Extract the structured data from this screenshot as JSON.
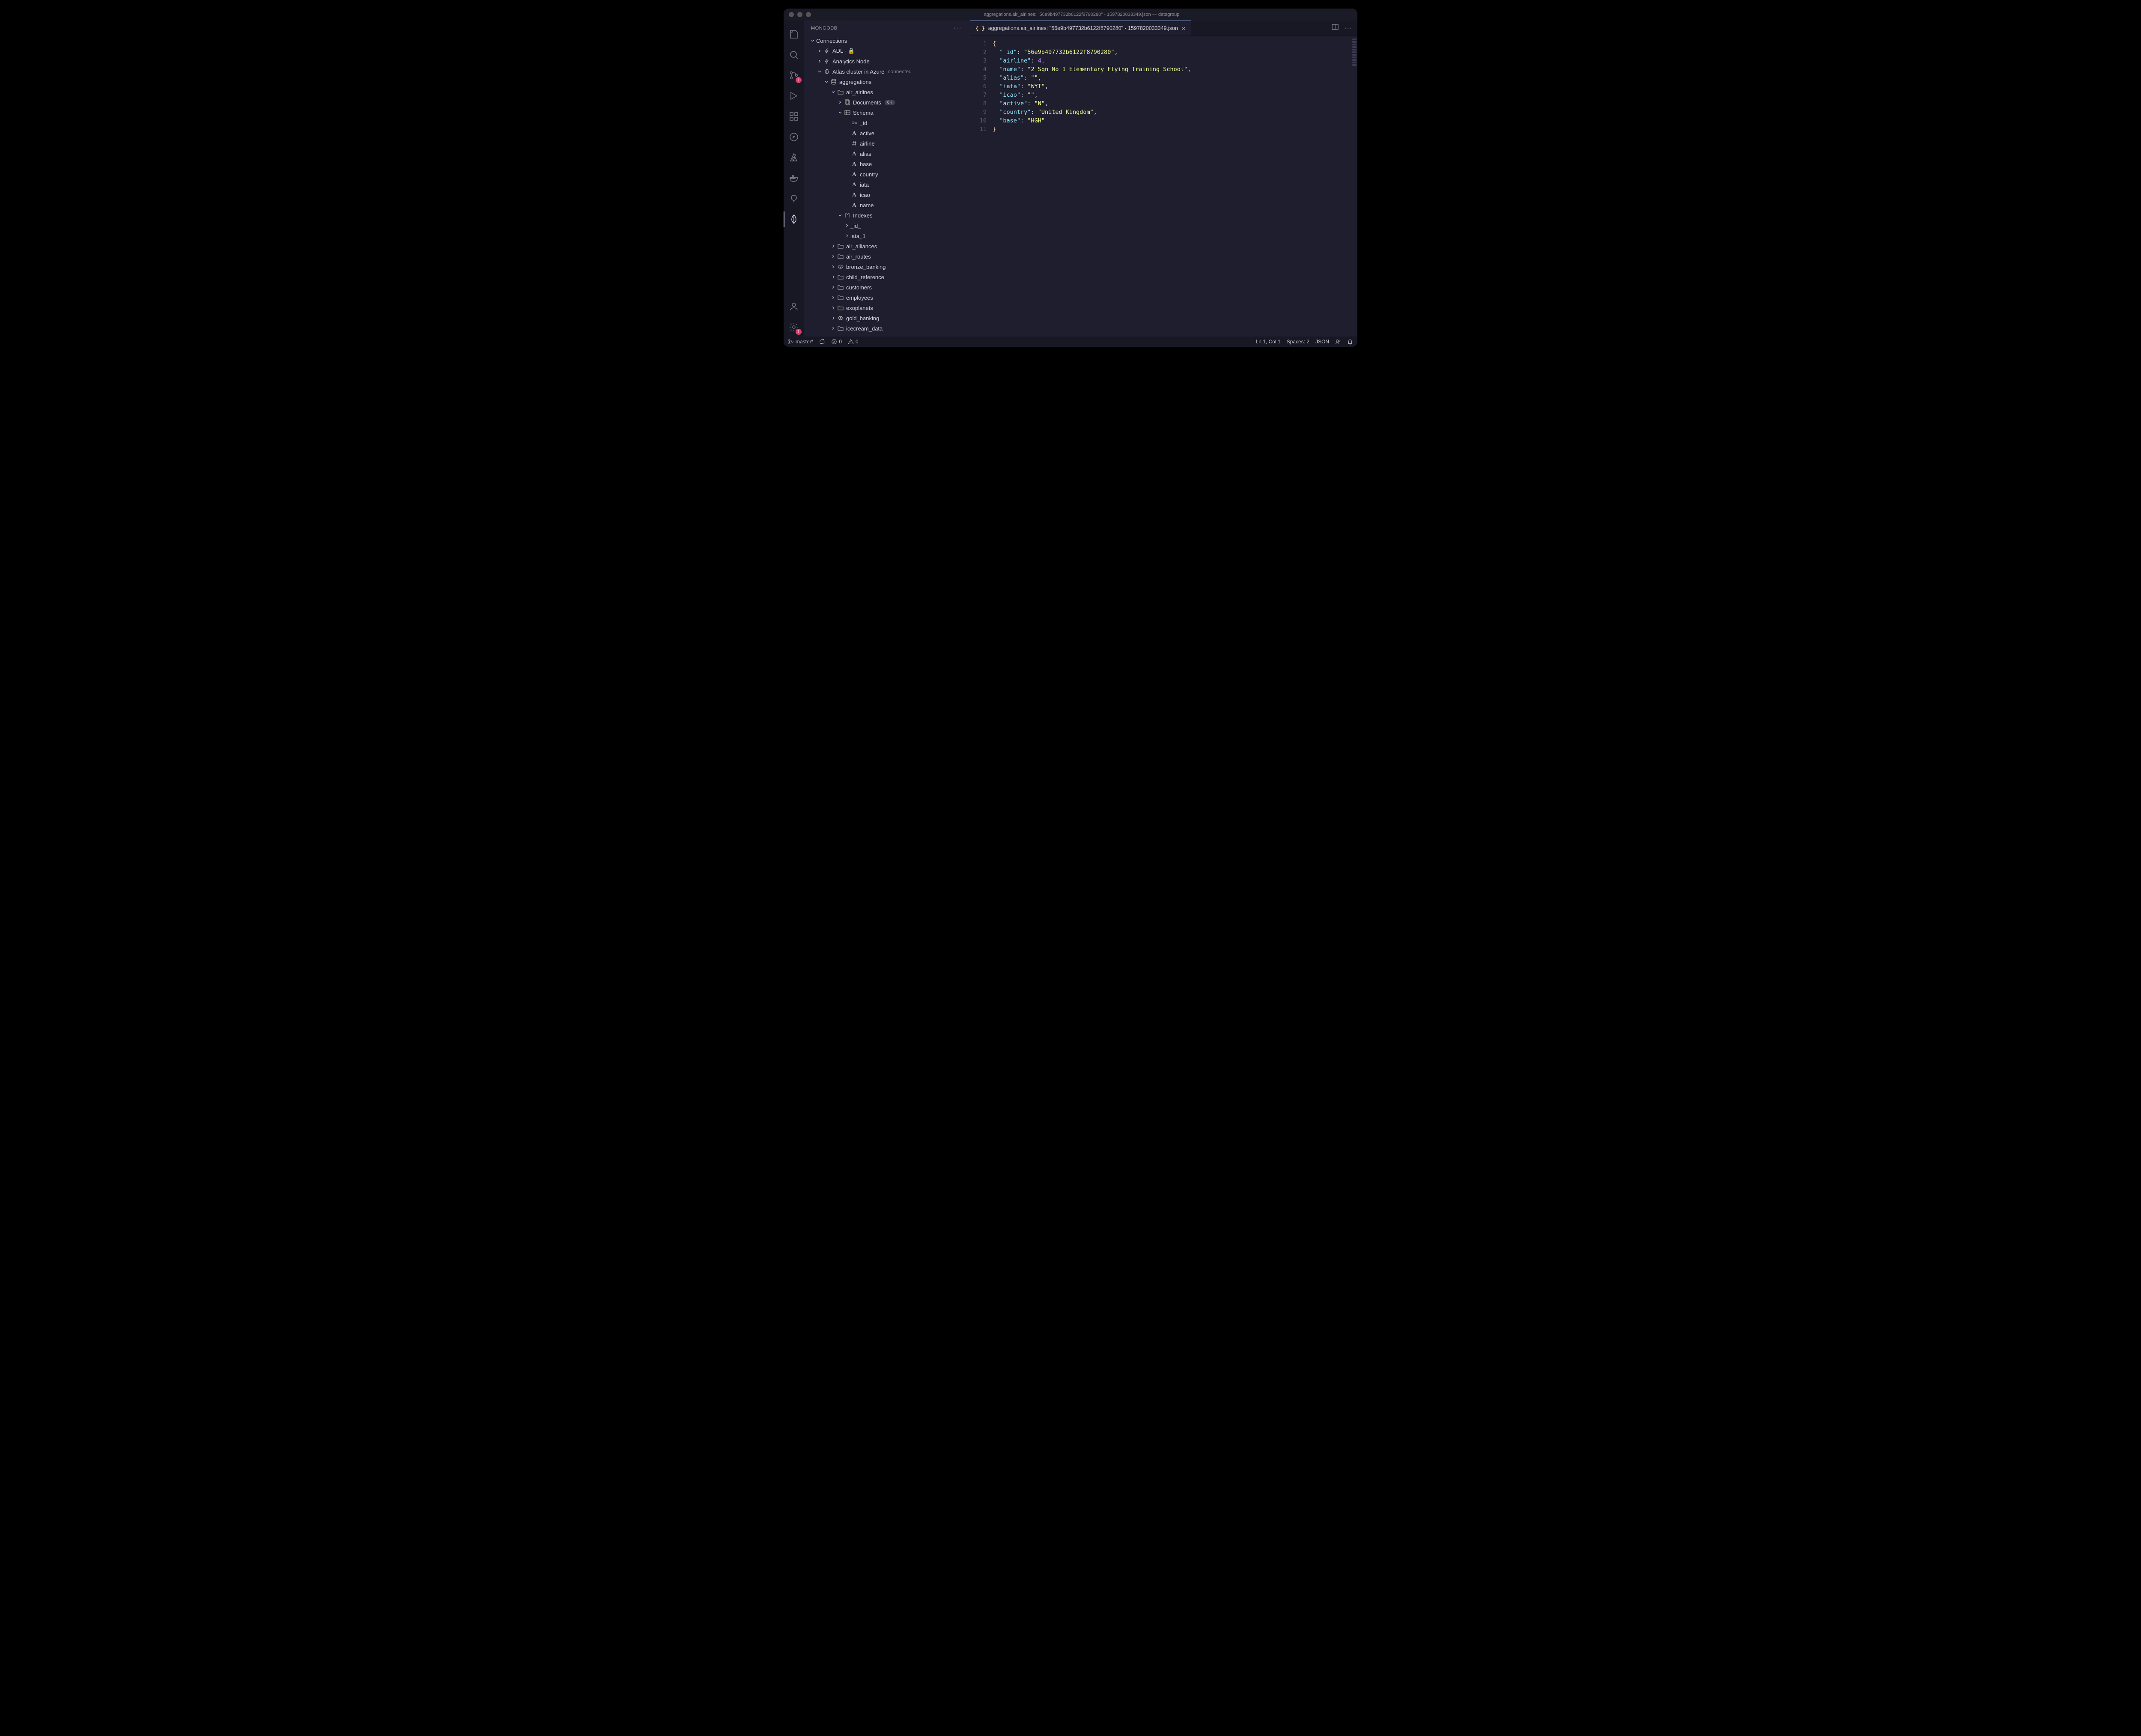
{
  "window": {
    "title": "aggregations.air_airlines: \"56e9b497732b6122f8790280\" - 1597820033349.json — datagroup"
  },
  "sidebar": {
    "title": "MONGODB",
    "section": "Connections",
    "connections": [
      {
        "label": "ADL - 🔒",
        "type": "bolt"
      },
      {
        "label": "Analytics Node",
        "type": "bolt"
      }
    ],
    "cluster": {
      "label": "Atlas cluster in Azure",
      "status": "connected"
    },
    "database": "aggregations",
    "collection": "air_airlines",
    "docs_label": "Documents",
    "docs_count": "6K",
    "schema_label": "Schema",
    "schema_fields": [
      {
        "name": "_id",
        "type": "key"
      },
      {
        "name": "active",
        "type": "str"
      },
      {
        "name": "airline",
        "type": "num"
      },
      {
        "name": "alias",
        "type": "str"
      },
      {
        "name": "base",
        "type": "str"
      },
      {
        "name": "country",
        "type": "str"
      },
      {
        "name": "iata",
        "type": "str"
      },
      {
        "name": "icao",
        "type": "str"
      },
      {
        "name": "name",
        "type": "str"
      }
    ],
    "indexes_label": "Indexes",
    "indexes": [
      "_id_",
      "iata_1"
    ],
    "other_collections": [
      {
        "name": "air_alliances",
        "view": false
      },
      {
        "name": "air_routes",
        "view": false
      },
      {
        "name": "bronze_banking",
        "view": true
      },
      {
        "name": "child_reference",
        "view": false
      },
      {
        "name": "customers",
        "view": false
      },
      {
        "name": "employees",
        "view": false
      },
      {
        "name": "exoplanets",
        "view": false
      },
      {
        "name": "gold_banking",
        "view": true
      },
      {
        "name": "icecream_data",
        "view": false
      }
    ]
  },
  "tab": {
    "filename": "aggregations.air_airlines: \"56e9b497732b6122f8790280\" - 1597820033349.json"
  },
  "json_doc": {
    "_id": "56e9b497732b6122f8790280",
    "airline": 4,
    "name": "2 Sqn No 1 Elementary Flying Training School",
    "alias": "",
    "iata": "WYT",
    "icao": "",
    "active": "N",
    "country": "United Kingdom",
    "base": "HGH"
  },
  "statusbar": {
    "branch": "master*",
    "errors": "0",
    "warnings": "0",
    "cursor": "Ln 1, Col 1",
    "spaces": "Spaces: 2",
    "lang": "JSON"
  },
  "activity_badges": {
    "scm": "1",
    "settings": "1"
  }
}
